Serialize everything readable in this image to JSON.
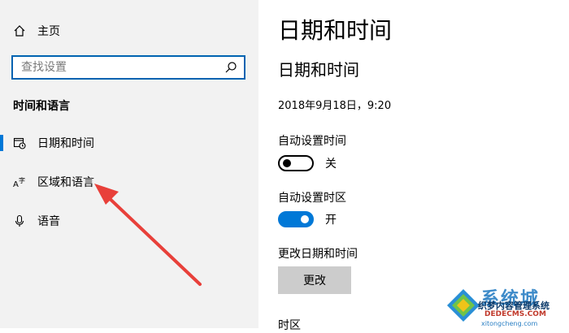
{
  "sidebar": {
    "home_label": "主页",
    "search_placeholder": "查找设置",
    "section_title": "时间和语言",
    "items": [
      {
        "label": "日期和时间",
        "icon": "calendar-clock-icon",
        "active": true
      },
      {
        "label": "区域和语言",
        "icon": "language-icon",
        "active": false
      },
      {
        "label": "语音",
        "icon": "microphone-icon",
        "active": false
      }
    ]
  },
  "main": {
    "page_title": "日期和时间",
    "sub_title": "日期和时间",
    "current_datetime": "2018年9月18日，9:20",
    "auto_time": {
      "label": "自动设置时间",
      "state_text": "关",
      "on": false
    },
    "auto_timezone": {
      "label": "自动设置时区",
      "state_text": "开",
      "on": true
    },
    "change": {
      "label": "更改日期和时间",
      "button_label": "更改"
    },
    "timezone_label": "时区"
  },
  "watermark": {
    "title": "系统城",
    "subtitle": "织梦内容管理系统",
    "domain": "DEDECMS.COM",
    "url": "xitongcheng.com"
  },
  "colors": {
    "accent": "#0078d7",
    "sidebar_bg": "#f2f2f2",
    "arrow": "#e8403a",
    "button_bg": "#cccccc"
  }
}
